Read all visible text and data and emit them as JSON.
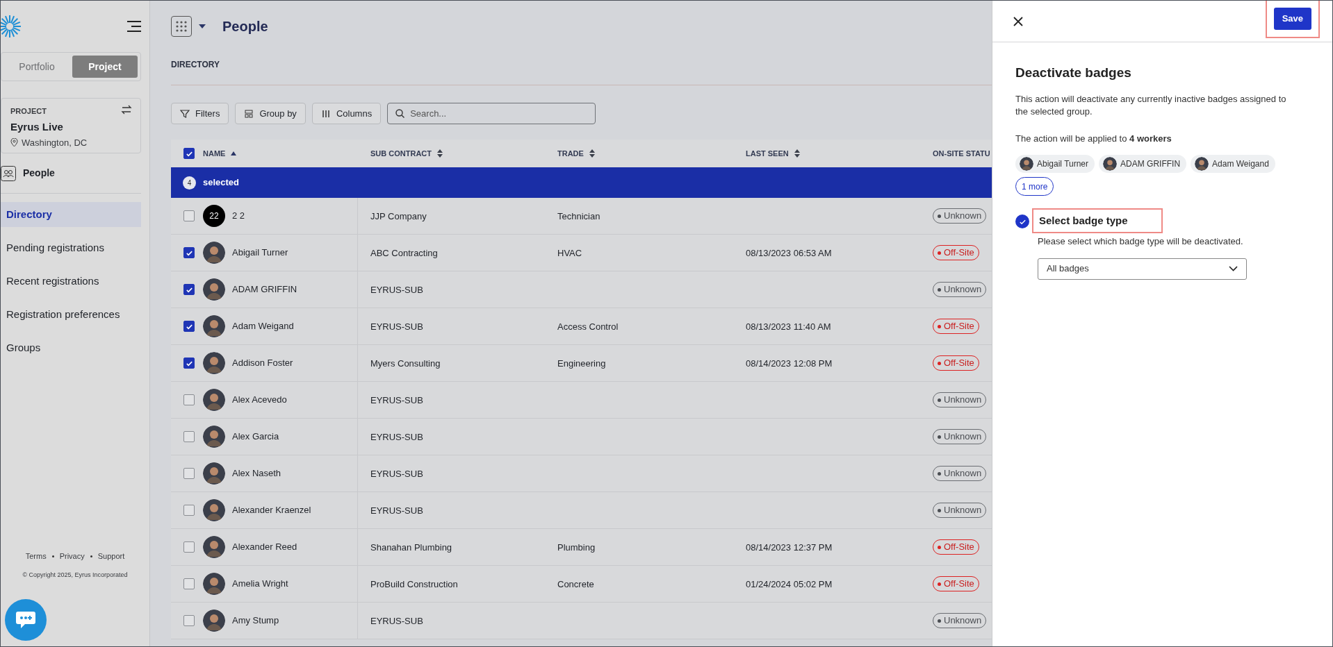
{
  "sidebar": {
    "scope_toggle": [
      {
        "label": "Portfolio",
        "selected": false
      },
      {
        "label": "Project",
        "selected": true
      }
    ],
    "project": {
      "caption": "PROJECT",
      "name": "Eyrus Live",
      "location": "Washington, DC"
    },
    "section": "People",
    "items": [
      {
        "label": "Directory",
        "selected": true
      },
      {
        "label": "Pending registrations",
        "selected": false
      },
      {
        "label": "Recent registrations",
        "selected": false
      },
      {
        "label": "Registration preferences",
        "selected": false
      },
      {
        "label": "Groups",
        "selected": false
      }
    ],
    "footer_links": [
      "Terms",
      "Privacy",
      "Support"
    ],
    "copyright": "© Copyright 2025, Eyrus Incorporated"
  },
  "header": {
    "title": "People",
    "subtitle": "DIRECTORY"
  },
  "toolbar": {
    "buttons": [
      {
        "label": "Filters",
        "kind": "filter"
      },
      {
        "label": "Group by",
        "kind": "group"
      },
      {
        "label": "Columns",
        "kind": "columns"
      }
    ],
    "search": {
      "placeholder": "Search..."
    }
  },
  "table": {
    "all_checked": true,
    "columns": [
      {
        "label": "NAME",
        "kind": "ascending"
      },
      {
        "label": "SUB CONTRACT",
        "kind": "sortable"
      },
      {
        "label": "TRADE",
        "kind": "sortable"
      },
      {
        "label": "LAST SEEN",
        "kind": "sortable"
      },
      {
        "label": "ON-SITE STATU",
        "kind": "plain"
      }
    ],
    "selection": {
      "count": "4",
      "label": "selected"
    },
    "rows": [
      {
        "selected": false,
        "avatar": {
          "kind": "initials",
          "text": "22"
        },
        "name": "2 2",
        "sub_contract": "JJP Company",
        "trade": "Technician",
        "last_seen": "",
        "status": {
          "label": "Unknown",
          "kind": "unknown"
        }
      },
      {
        "selected": true,
        "avatar": {
          "kind": "photo"
        },
        "name": "Abigail Turner",
        "sub_contract": "ABC Contracting",
        "trade": "HVAC",
        "last_seen": "08/13/2023 06:53 AM",
        "status": {
          "label": "Off-Site",
          "kind": "offsite"
        }
      },
      {
        "selected": true,
        "avatar": {
          "kind": "photo"
        },
        "name": "ADAM GRIFFIN",
        "sub_contract": "EYRUS-SUB",
        "trade": "",
        "last_seen": "",
        "status": {
          "label": "Unknown",
          "kind": "unknown"
        }
      },
      {
        "selected": true,
        "avatar": {
          "kind": "photo"
        },
        "name": "Adam Weigand",
        "sub_contract": "EYRUS-SUB",
        "trade": "Access Control",
        "last_seen": "08/13/2023 11:40 AM",
        "status": {
          "label": "Off-Site",
          "kind": "offsite"
        }
      },
      {
        "selected": true,
        "avatar": {
          "kind": "photo"
        },
        "name": "Addison Foster",
        "sub_contract": "Myers Consulting",
        "trade": "Engineering",
        "last_seen": "08/14/2023 12:08 PM",
        "status": {
          "label": "Off-Site",
          "kind": "offsite"
        }
      },
      {
        "selected": false,
        "avatar": {
          "kind": "photo"
        },
        "name": "Alex Acevedo",
        "sub_contract": "EYRUS-SUB",
        "trade": "",
        "last_seen": "",
        "status": {
          "label": "Unknown",
          "kind": "unknown"
        }
      },
      {
        "selected": false,
        "avatar": {
          "kind": "photo"
        },
        "name": "Alex Garcia",
        "sub_contract": "EYRUS-SUB",
        "trade": "",
        "last_seen": "",
        "status": {
          "label": "Unknown",
          "kind": "unknown"
        }
      },
      {
        "selected": false,
        "avatar": {
          "kind": "photo"
        },
        "name": "Alex Naseth",
        "sub_contract": "EYRUS-SUB",
        "trade": "",
        "last_seen": "",
        "status": {
          "label": "Unknown",
          "kind": "unknown"
        }
      },
      {
        "selected": false,
        "avatar": {
          "kind": "photo"
        },
        "name": "Alexander Kraenzel",
        "sub_contract": "EYRUS-SUB",
        "trade": "",
        "last_seen": "",
        "status": {
          "label": "Unknown",
          "kind": "unknown"
        }
      },
      {
        "selected": false,
        "avatar": {
          "kind": "photo"
        },
        "name": "Alexander Reed",
        "sub_contract": "Shanahan Plumbing",
        "trade": "Plumbing",
        "last_seen": "08/14/2023 12:37 PM",
        "status": {
          "label": "Off-Site",
          "kind": "offsite"
        }
      },
      {
        "selected": false,
        "avatar": {
          "kind": "photo"
        },
        "name": "Amelia Wright",
        "sub_contract": "ProBuild Construction",
        "trade": "Concrete",
        "last_seen": "01/24/2024 05:02 PM",
        "status": {
          "label": "Off-Site",
          "kind": "offsite"
        }
      },
      {
        "selected": false,
        "avatar": {
          "kind": "photo"
        },
        "name": "Amy Stump",
        "sub_contract": "EYRUS-SUB",
        "trade": "",
        "last_seen": "",
        "status": {
          "label": "Unknown",
          "kind": "unknown"
        }
      }
    ]
  },
  "panel": {
    "save": {
      "label": "Save",
      "highlighted": true
    },
    "title": "Deactivate badges",
    "description": "This action will deactivate any currently inactive badges assigned to the selected group.",
    "applied_to": "The action will be applied to **4 workers**",
    "workers": [
      "Abigail Turner",
      "ADAM GRIFFIN",
      "Adam Weigand"
    ],
    "more": "1 more",
    "step": {
      "done": true,
      "title": "Select badge type",
      "highlighted": true,
      "hint": "Please select which badge type will be deactivated.",
      "select_value": "All badges"
    }
  }
}
